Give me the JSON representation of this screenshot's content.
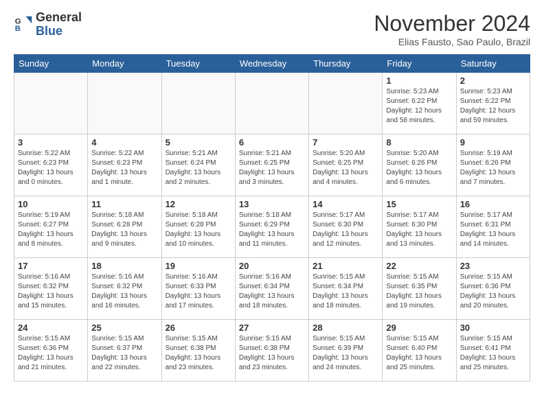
{
  "header": {
    "logo_general": "General",
    "logo_blue": "Blue",
    "month_title": "November 2024",
    "location": "Elias Fausto, Sao Paulo, Brazil"
  },
  "weekdays": [
    "Sunday",
    "Monday",
    "Tuesday",
    "Wednesday",
    "Thursday",
    "Friday",
    "Saturday"
  ],
  "weeks": [
    [
      {
        "day": "",
        "info": ""
      },
      {
        "day": "",
        "info": ""
      },
      {
        "day": "",
        "info": ""
      },
      {
        "day": "",
        "info": ""
      },
      {
        "day": "",
        "info": ""
      },
      {
        "day": "1",
        "info": "Sunrise: 5:23 AM\nSunset: 6:22 PM\nDaylight: 12 hours and 58 minutes."
      },
      {
        "day": "2",
        "info": "Sunrise: 5:23 AM\nSunset: 6:22 PM\nDaylight: 12 hours and 59 minutes."
      }
    ],
    [
      {
        "day": "3",
        "info": "Sunrise: 5:22 AM\nSunset: 6:23 PM\nDaylight: 13 hours and 0 minutes."
      },
      {
        "day": "4",
        "info": "Sunrise: 5:22 AM\nSunset: 6:23 PM\nDaylight: 13 hours and 1 minute."
      },
      {
        "day": "5",
        "info": "Sunrise: 5:21 AM\nSunset: 6:24 PM\nDaylight: 13 hours and 2 minutes."
      },
      {
        "day": "6",
        "info": "Sunrise: 5:21 AM\nSunset: 6:25 PM\nDaylight: 13 hours and 3 minutes."
      },
      {
        "day": "7",
        "info": "Sunrise: 5:20 AM\nSunset: 6:25 PM\nDaylight: 13 hours and 4 minutes."
      },
      {
        "day": "8",
        "info": "Sunrise: 5:20 AM\nSunset: 6:26 PM\nDaylight: 13 hours and 6 minutes."
      },
      {
        "day": "9",
        "info": "Sunrise: 5:19 AM\nSunset: 6:26 PM\nDaylight: 13 hours and 7 minutes."
      }
    ],
    [
      {
        "day": "10",
        "info": "Sunrise: 5:19 AM\nSunset: 6:27 PM\nDaylight: 13 hours and 8 minutes."
      },
      {
        "day": "11",
        "info": "Sunrise: 5:18 AM\nSunset: 6:28 PM\nDaylight: 13 hours and 9 minutes."
      },
      {
        "day": "12",
        "info": "Sunrise: 5:18 AM\nSunset: 6:28 PM\nDaylight: 13 hours and 10 minutes."
      },
      {
        "day": "13",
        "info": "Sunrise: 5:18 AM\nSunset: 6:29 PM\nDaylight: 13 hours and 11 minutes."
      },
      {
        "day": "14",
        "info": "Sunrise: 5:17 AM\nSunset: 6:30 PM\nDaylight: 13 hours and 12 minutes."
      },
      {
        "day": "15",
        "info": "Sunrise: 5:17 AM\nSunset: 6:30 PM\nDaylight: 13 hours and 13 minutes."
      },
      {
        "day": "16",
        "info": "Sunrise: 5:17 AM\nSunset: 6:31 PM\nDaylight: 13 hours and 14 minutes."
      }
    ],
    [
      {
        "day": "17",
        "info": "Sunrise: 5:16 AM\nSunset: 6:32 PM\nDaylight: 13 hours and 15 minutes."
      },
      {
        "day": "18",
        "info": "Sunrise: 5:16 AM\nSunset: 6:32 PM\nDaylight: 13 hours and 16 minutes."
      },
      {
        "day": "19",
        "info": "Sunrise: 5:16 AM\nSunset: 6:33 PM\nDaylight: 13 hours and 17 minutes."
      },
      {
        "day": "20",
        "info": "Sunrise: 5:16 AM\nSunset: 6:34 PM\nDaylight: 13 hours and 18 minutes."
      },
      {
        "day": "21",
        "info": "Sunrise: 5:15 AM\nSunset: 6:34 PM\nDaylight: 13 hours and 18 minutes."
      },
      {
        "day": "22",
        "info": "Sunrise: 5:15 AM\nSunset: 6:35 PM\nDaylight: 13 hours and 19 minutes."
      },
      {
        "day": "23",
        "info": "Sunrise: 5:15 AM\nSunset: 6:36 PM\nDaylight: 13 hours and 20 minutes."
      }
    ],
    [
      {
        "day": "24",
        "info": "Sunrise: 5:15 AM\nSunset: 6:36 PM\nDaylight: 13 hours and 21 minutes."
      },
      {
        "day": "25",
        "info": "Sunrise: 5:15 AM\nSunset: 6:37 PM\nDaylight: 13 hours and 22 minutes."
      },
      {
        "day": "26",
        "info": "Sunrise: 5:15 AM\nSunset: 6:38 PM\nDaylight: 13 hours and 23 minutes."
      },
      {
        "day": "27",
        "info": "Sunrise: 5:15 AM\nSunset: 6:38 PM\nDaylight: 13 hours and 23 minutes."
      },
      {
        "day": "28",
        "info": "Sunrise: 5:15 AM\nSunset: 6:39 PM\nDaylight: 13 hours and 24 minutes."
      },
      {
        "day": "29",
        "info": "Sunrise: 5:15 AM\nSunset: 6:40 PM\nDaylight: 13 hours and 25 minutes."
      },
      {
        "day": "30",
        "info": "Sunrise: 5:15 AM\nSunset: 6:41 PM\nDaylight: 13 hours and 25 minutes."
      }
    ]
  ]
}
